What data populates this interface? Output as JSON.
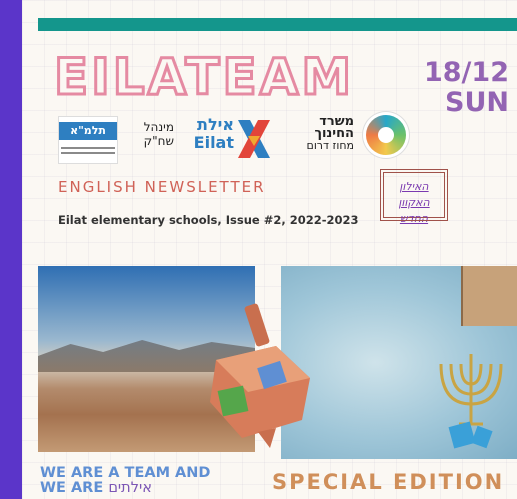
{
  "masthead": {
    "title": "EILATEAM"
  },
  "date": {
    "day": "18/12",
    "weekday": "SUN"
  },
  "logos": {
    "talma": "תלמ\"א",
    "minhal": "מינהל שח\"ק",
    "eilat_he": "אילת",
    "eilat_en": "Eilat",
    "misrad": "משרד החינוך",
    "misrad_sub": "מחוז דרום"
  },
  "newsletter": {
    "label": "ENGLISH  NEWSLETTER",
    "subtitle": "Eilat elementary schools, Issue #2, 2022-2023"
  },
  "stamp": {
    "line1": "האילון האקוון",
    "line2": "החדש"
  },
  "headlines": {
    "left_line1": "WE ARE A TEAM AND",
    "left_line2": "WE ARE",
    "left_hebrew": "אילתים",
    "right": "SPECIAL EDITION"
  },
  "colors": {
    "frame": "#5b35c9",
    "teal": "#14968c",
    "pink": "#e58aa2",
    "purple": "#9364b3",
    "coral": "#d06257"
  }
}
